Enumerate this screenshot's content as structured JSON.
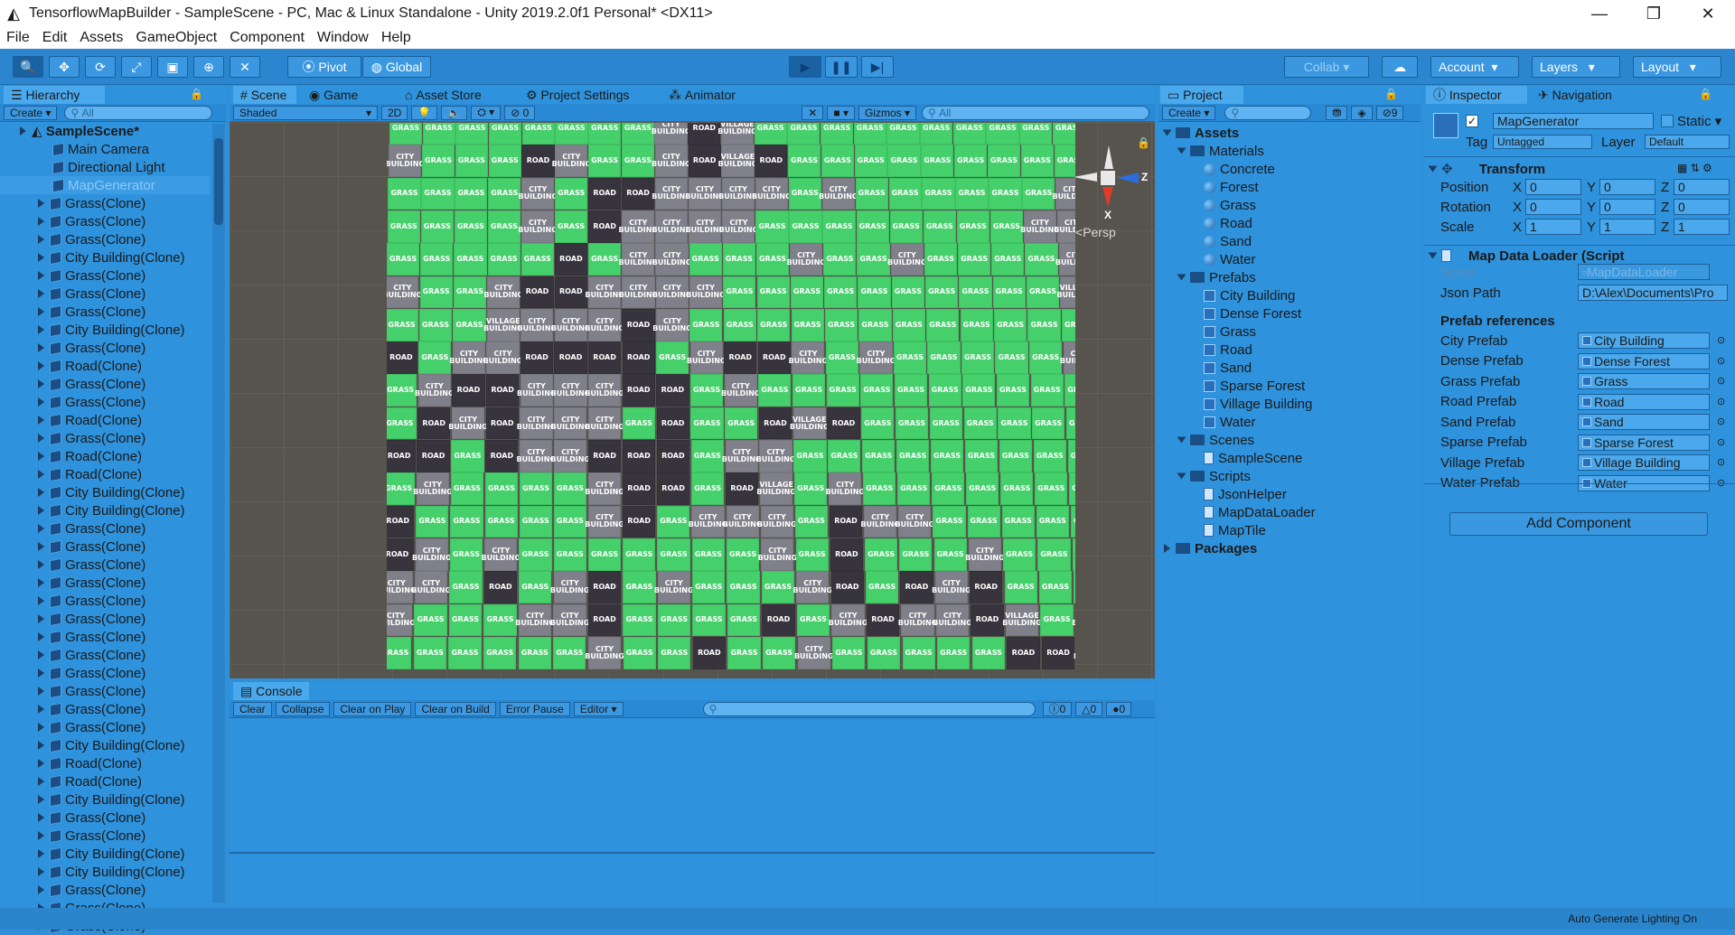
{
  "window": {
    "title": "TensorflowMapBuilder - SampleScene - PC, Mac & Linux Standalone - Unity 2019.2.0f1 Personal* <DX11>",
    "minimize": "—",
    "restore": "❐",
    "close": "✕"
  },
  "menu": [
    "File",
    "Edit",
    "Assets",
    "GameObject",
    "Component",
    "Window",
    "Help"
  ],
  "toolbar": {
    "pivot": "Pivot",
    "global": "Global",
    "collab": "Collab",
    "account": "Account",
    "layers": "Layers",
    "layout": "Layout"
  },
  "hierarchy": {
    "tab": "Hierarchy",
    "create": "Create",
    "search_placeholder": "All",
    "scene": "SampleScene*",
    "items": [
      "Main Camera",
      "Directional Light",
      "MapGenerator",
      "Grass(Clone)",
      "Grass(Clone)",
      "Grass(Clone)",
      "City Building(Clone)",
      "Grass(Clone)",
      "Grass(Clone)",
      "Grass(Clone)",
      "City Building(Clone)",
      "Grass(Clone)",
      "Road(Clone)",
      "Grass(Clone)",
      "Grass(Clone)",
      "Road(Clone)",
      "Grass(Clone)",
      "Road(Clone)",
      "Road(Clone)",
      "City Building(Clone)",
      "City Building(Clone)",
      "Grass(Clone)",
      "Grass(Clone)",
      "Grass(Clone)",
      "Grass(Clone)",
      "Grass(Clone)",
      "Grass(Clone)",
      "Grass(Clone)",
      "Grass(Clone)",
      "Grass(Clone)",
      "Grass(Clone)",
      "Grass(Clone)",
      "Grass(Clone)",
      "City Building(Clone)",
      "Road(Clone)",
      "Road(Clone)",
      "City Building(Clone)",
      "Grass(Clone)",
      "Grass(Clone)",
      "City Building(Clone)",
      "City Building(Clone)",
      "Grass(Clone)",
      "Grass(Clone)",
      "Grass(Clone)"
    ]
  },
  "center_tabs": [
    "Scene",
    "Game",
    "Asset Store",
    "Project Settings",
    "Animator"
  ],
  "scene_toolbar": {
    "shading": "Shaded",
    "mode2d": "2D",
    "hidden_count": "0",
    "gizmos": "Gizmos",
    "search_placeholder": "All"
  },
  "gizmo": {
    "x": "X",
    "z": "Z",
    "persp": "Persp"
  },
  "map_labels": {
    "g": "GRASS",
    "c": "CITY BUILDING",
    "r": "ROAD",
    "v": "VILLAGE BUILDING"
  },
  "map_rows": [
    "ggggggggcrvgggggggggggg",
    "cgggrcggcrvrggggggggggg",
    "ggggcgrrccccgcggggggccg",
    "ggggcgrccccggggggggccgg",
    "gggggrgccgggcggcggggcgg",
    "cggcrrccccggggggggggvgg",
    "gggvcccrcgggggggggggggc",
    "rgccrrrrgcrrcgcgggggccg",
    "gcrrcccrrgcgggggggggggr",
    "grcrcccgrggrvrggggggggc",
    "rrgrccrrrgccggggggggggc",
    "gcggggcrrgrvgcggggggggr",
    "rgggggcrgcccgrccggggggg",
    "rcgcgggggggcgrgggcggggg",
    "ccgrgcrgcgggcrgrcrgggcg",
    "cgggccrggggrgcrccrvgcgg",
    "ggggggcggrggcgggggrrccr"
  ],
  "console": {
    "tab": "Console",
    "buttons": [
      "Clear",
      "Collapse",
      "Clear on Play",
      "Clear on Build",
      "Error Pause",
      "Editor"
    ],
    "errors": "0",
    "warnings": "0",
    "messages": "0"
  },
  "project": {
    "tab": "Project",
    "create": "Create",
    "hidden_count": "9",
    "assets": "Assets",
    "materials_folder": "Materials",
    "materials": [
      "Concrete",
      "Forest",
      "Grass",
      "Road",
      "Sand",
      "Water"
    ],
    "prefabs_folder": "Prefabs",
    "prefabs": [
      "City Building",
      "Dense Forest",
      "Grass",
      "Road",
      "Sand",
      "Sparse Forest",
      "Village Building",
      "Water"
    ],
    "scenes_folder": "Scenes",
    "scenes": [
      "SampleScene"
    ],
    "scripts_folder": "Scripts",
    "scripts": [
      "JsonHelper",
      "MapDataLoader",
      "MapTile"
    ],
    "packages": "Packages"
  },
  "inspector": {
    "tabs": [
      "Inspector",
      "Navigation"
    ],
    "object_name": "MapGenerator",
    "static_label": "Static",
    "tag_label": "Tag",
    "tag_value": "Untagged",
    "layer_label": "Layer",
    "layer_value": "Default",
    "transform": {
      "title": "Transform",
      "rows": [
        {
          "label": "Position",
          "x": "0",
          "y": "0",
          "z": "0"
        },
        {
          "label": "Rotation",
          "x": "0",
          "y": "0",
          "z": "0"
        },
        {
          "label": "Scale",
          "x": "1",
          "y": "1",
          "z": "1"
        }
      ]
    },
    "script_component": {
      "title": "Map Data Loader (Script",
      "script_label": "Script",
      "script_value": "MapDataLoader",
      "json_label": "Json Path",
      "json_value": "D:\\Alex\\Documents\\Pro",
      "section": "Prefab references",
      "refs": [
        {
          "label": "City Prefab",
          "value": "City Building"
        },
        {
          "label": "Dense Prefab",
          "value": "Dense Forest"
        },
        {
          "label": "Grass Prefab",
          "value": "Grass"
        },
        {
          "label": "Road Prefab",
          "value": "Road"
        },
        {
          "label": "Sand Prefab",
          "value": "Sand"
        },
        {
          "label": "Sparse Prefab",
          "value": "Sparse Forest"
        },
        {
          "label": "Village Prefab",
          "value": "Village Building"
        },
        {
          "label": "Water Prefab",
          "value": "Water"
        }
      ]
    },
    "add_component": "Add Component"
  },
  "status": {
    "text": "Auto Generate Lighting On"
  }
}
